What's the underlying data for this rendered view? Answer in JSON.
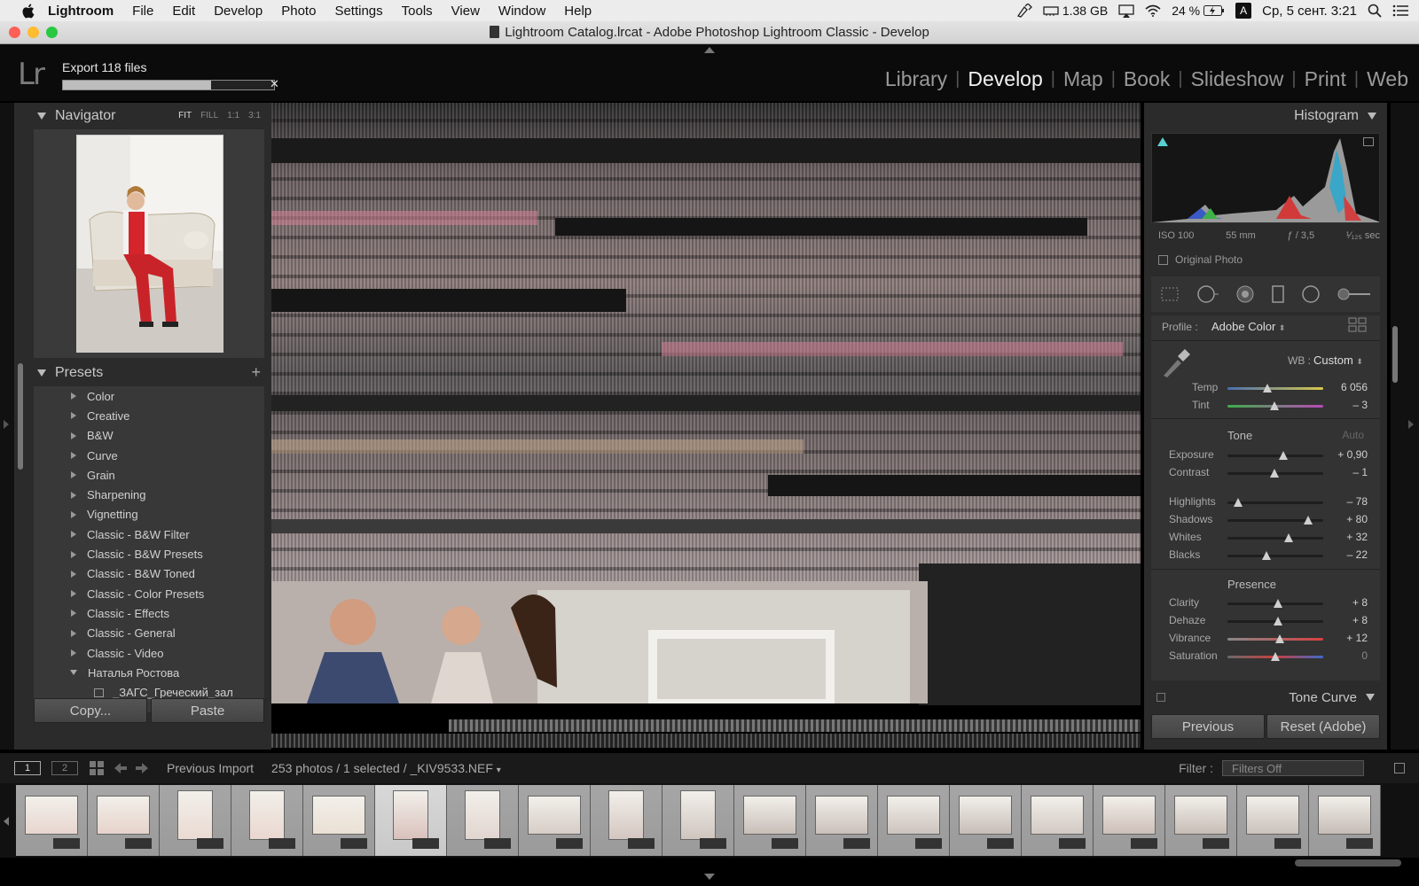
{
  "menubar": {
    "app": "Lightroom",
    "items": [
      "File",
      "Edit",
      "Develop",
      "Photo",
      "Settings",
      "Tools",
      "View",
      "Window",
      "Help"
    ],
    "memory": "1.38 GB",
    "battery": "24 %",
    "input_source": "A",
    "clock": "Ср, 5 сент.  3:21"
  },
  "window": {
    "title": "Lightroom Catalog.lrcat - Adobe Photoshop Lightroom Classic - Develop"
  },
  "top": {
    "logo": "Lr",
    "export_title": "Export 118 files",
    "export_progress": 0.7,
    "close_glyph": "✕",
    "modules": [
      "Library",
      "Develop",
      "Map",
      "Book",
      "Slideshow",
      "Print",
      "Web"
    ],
    "active_module": "Develop"
  },
  "navigator": {
    "title": "Navigator",
    "zoom": [
      "FIT",
      "FILL",
      "1:1",
      "3:1"
    ],
    "zoom_active": "FIT"
  },
  "presets": {
    "title": "Presets",
    "add": "+",
    "items": [
      "Color",
      "Creative",
      "B&W",
      "Curve",
      "Grain",
      "Sharpening",
      "Vignetting",
      "Classic - B&W Filter",
      "Classic - B&W Presets",
      "Classic - B&W Toned",
      "Classic - Color Presets",
      "Classic - Effects",
      "Classic - General",
      "Classic - Video",
      "Наталья Ростова"
    ],
    "child": "_ЗАГС_Греческий_зал"
  },
  "left_buttons": {
    "copy": "Copy...",
    "paste": "Paste"
  },
  "histogram": {
    "title": "Histogram",
    "iso": "ISO 100",
    "focal": "55 mm",
    "aperture": "ƒ / 3,5",
    "shutter": "¹⁄₁₂₅ sec",
    "original_photo": "Original Photo"
  },
  "basic": {
    "profile_label": "Profile :",
    "profile_value": "Adobe Color",
    "wb_label": "WB :",
    "wb_value": "Custom",
    "tone_title": "Tone",
    "auto": "Auto",
    "presence_title": "Presence",
    "sliders": {
      "temp": {
        "label": "Temp",
        "value": "6 056",
        "pos": 0.42
      },
      "tint": {
        "label": "Tint",
        "value": "– 3",
        "pos": 0.49
      },
      "exposure": {
        "label": "Exposure",
        "value": "+ 0,90",
        "pos": 0.58
      },
      "contrast": {
        "label": "Contrast",
        "value": "– 1",
        "pos": 0.49
      },
      "highlights": {
        "label": "Highlights",
        "value": "– 78",
        "pos": 0.11
      },
      "shadows": {
        "label": "Shadows",
        "value": "+ 80",
        "pos": 0.84
      },
      "whites": {
        "label": "Whites",
        "value": "+ 32",
        "pos": 0.64
      },
      "blacks": {
        "label": "Blacks",
        "value": "– 22",
        "pos": 0.41
      },
      "clarity": {
        "label": "Clarity",
        "value": "+ 8",
        "pos": 0.53
      },
      "dehaze": {
        "label": "Dehaze",
        "value": "+ 8",
        "pos": 0.53
      },
      "vibrance": {
        "label": "Vibrance",
        "value": "+ 12",
        "pos": 0.55
      },
      "saturation": {
        "label": "Saturation",
        "value": "0",
        "pos": 0.5
      }
    }
  },
  "tone_curve": {
    "title": "Tone Curve"
  },
  "right_buttons": {
    "previous": "Previous",
    "reset": "Reset (Adobe)"
  },
  "filmstrip_bar": {
    "monitor1": "1",
    "monitor2": "2",
    "source": "Previous Import",
    "selection": "253 photos / 1 selected / _KIV9533.NEF",
    "filter_label": "Filter :",
    "filter_value": "Filters Off"
  },
  "colors": {
    "panel": "#2b2b2b",
    "accent_active_module": "#f2f2f2",
    "menubar": "#ececec",
    "traffic_red": "#fe5f57",
    "traffic_yellow": "#febc2e",
    "traffic_green": "#28c840"
  }
}
